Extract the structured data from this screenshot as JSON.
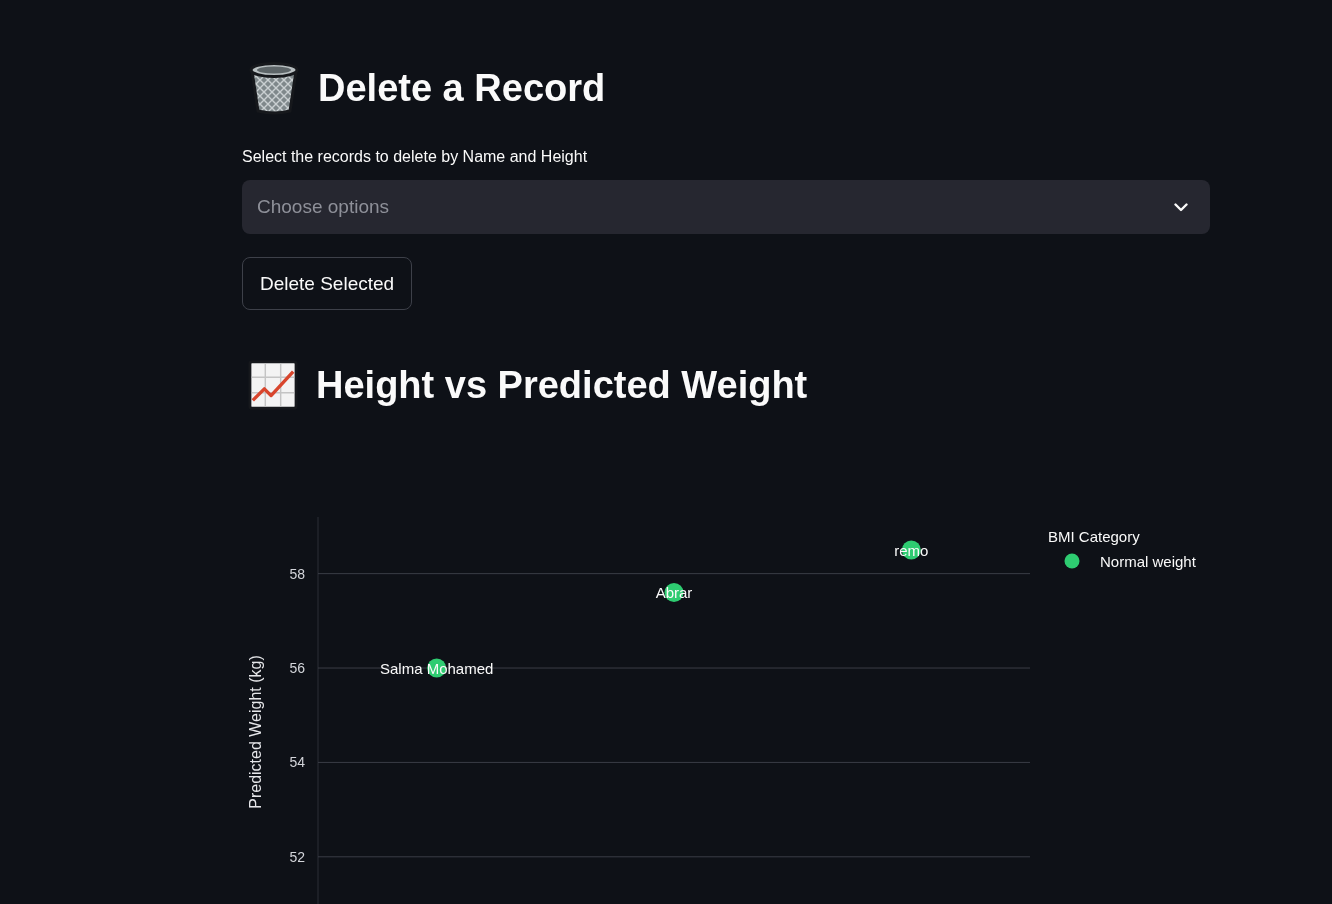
{
  "delete_record": {
    "title": "Delete a Record",
    "select": {
      "label": "Select the records to delete by Name and Height",
      "placeholder": "Choose options"
    },
    "button": "Delete Selected"
  },
  "chart_section": {
    "title": "Height vs Predicted Weight",
    "chart_data": [
      {
        "type": "scatter",
        "ylabel": "Predicted Weight (kg)",
        "legend_title": "BMI Category",
        "legend": "right",
        "categories": [
          null,
          null,
          null
        ],
        "series": [
          {
            "name": "Normal weight",
            "color": "#2ecc71",
            "values": [
              56.0,
              57.6,
              58.5
            ],
            "value_labels": [
              "Salma Mohamed",
              "Abrar",
              "remo"
            ]
          }
        ],
        "tick_labels": "y",
        "yticks": [
          52,
          54,
          56,
          58
        ],
        "ylim": [
          51,
          59.2
        ],
        "grid": true
      }
    ]
  }
}
